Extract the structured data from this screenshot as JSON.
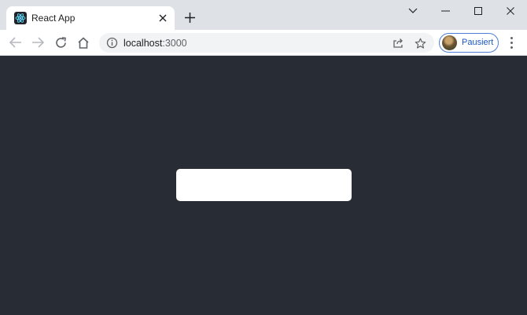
{
  "browser": {
    "tab": {
      "title": "React App",
      "favicon": "react-logo-icon"
    },
    "address_bar": {
      "host": "localhost",
      "port": ":3000"
    },
    "profile": {
      "label": "Pausiert"
    }
  },
  "page": {
    "background_color": "#282c34",
    "center_box_color": "#ffffff"
  }
}
